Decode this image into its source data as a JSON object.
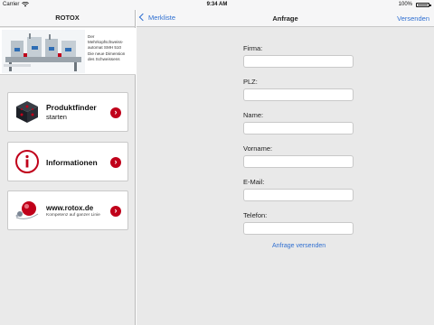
{
  "status_bar": {
    "carrier": "Carrier",
    "time": "9:34 AM",
    "battery": "100%"
  },
  "left_panel": {
    "title": "ROTOX",
    "promo": {
      "line1": "Der",
      "line2": "Mehrkopfschweiss-",
      "line3": "automat SMH 510",
      "line4": "Die neue Dimension",
      "line5": "des Schweissens"
    },
    "cards": [
      {
        "title": "Produktfinder",
        "subtitle": "starten",
        "icon": "cube-icon"
      },
      {
        "title": "Informationen",
        "icon": "info-icon"
      },
      {
        "title": "www.rotox.de",
        "subtitle": "Kompetenz auf ganzer Linie",
        "icon": "rotox-logo-icon"
      }
    ]
  },
  "right_panel": {
    "back_label": "Merkliste",
    "title": "Anfrage",
    "send_label": "Versenden",
    "fields": [
      {
        "label": "Firma:",
        "value": ""
      },
      {
        "label": "PLZ:",
        "value": ""
      },
      {
        "label": "Name:",
        "value": ""
      },
      {
        "label": "Vorname:",
        "value": ""
      },
      {
        "label": "E-Mail:",
        "value": ""
      },
      {
        "label": "Telefon:",
        "value": ""
      }
    ],
    "submit_label": "Anfrage versenden"
  },
  "colors": {
    "accent": "#2f6fd1",
    "brand_red": "#c0001a",
    "background": "#e9e9e9"
  }
}
